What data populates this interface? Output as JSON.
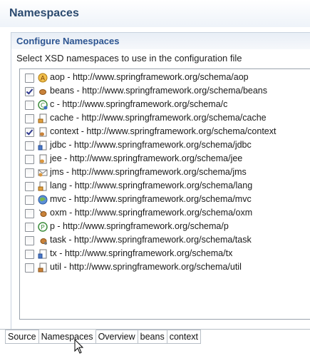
{
  "header": {
    "title": "Namespaces"
  },
  "section": {
    "title": "Configure Namespaces",
    "description": "Select XSD namespaces to use in the configuration file"
  },
  "namespaces": [
    {
      "label": "aop - http://www.springframework.org/schema/aop",
      "checked": false,
      "icon": "aop-icon"
    },
    {
      "label": "beans - http://www.springframework.org/schema/beans",
      "checked": true,
      "icon": "bean-icon"
    },
    {
      "label": "c - http://www.springframework.org/schema/c",
      "checked": false,
      "icon": "c-icon"
    },
    {
      "label": "cache - http://www.springframework.org/schema/cache",
      "checked": false,
      "icon": "cache-icon"
    },
    {
      "label": "context - http://www.springframework.org/schema/context",
      "checked": true,
      "icon": "context-icon"
    },
    {
      "label": "jdbc - http://www.springframework.org/schema/jdbc",
      "checked": false,
      "icon": "jdbc-icon"
    },
    {
      "label": "jee - http://www.springframework.org/schema/jee",
      "checked": false,
      "icon": "jee-icon"
    },
    {
      "label": "jms - http://www.springframework.org/schema/jms",
      "checked": false,
      "icon": "jms-icon"
    },
    {
      "label": "lang - http://www.springframework.org/schema/lang",
      "checked": false,
      "icon": "lang-icon"
    },
    {
      "label": "mvc - http://www.springframework.org/schema/mvc",
      "checked": false,
      "icon": "mvc-icon"
    },
    {
      "label": "oxm - http://www.springframework.org/schema/oxm",
      "checked": false,
      "icon": "oxm-icon"
    },
    {
      "label": "p - http://www.springframework.org/schema/p",
      "checked": false,
      "icon": "p-icon"
    },
    {
      "label": "task - http://www.springframework.org/schema/task",
      "checked": false,
      "icon": "task-icon"
    },
    {
      "label": "tx - http://www.springframework.org/schema/tx",
      "checked": false,
      "icon": "tx-icon"
    },
    {
      "label": "util - http://www.springframework.org/schema/util",
      "checked": false,
      "icon": "util-icon"
    }
  ],
  "tabs": [
    {
      "label": "Source",
      "active": false
    },
    {
      "label": "Namespaces",
      "active": true
    },
    {
      "label": "Overview",
      "active": false
    },
    {
      "label": "beans",
      "active": false
    },
    {
      "label": "context",
      "active": false
    }
  ],
  "colors": {
    "title": "#2b4a6f",
    "section_title": "#2d5591",
    "check": "#2f3a8f"
  }
}
